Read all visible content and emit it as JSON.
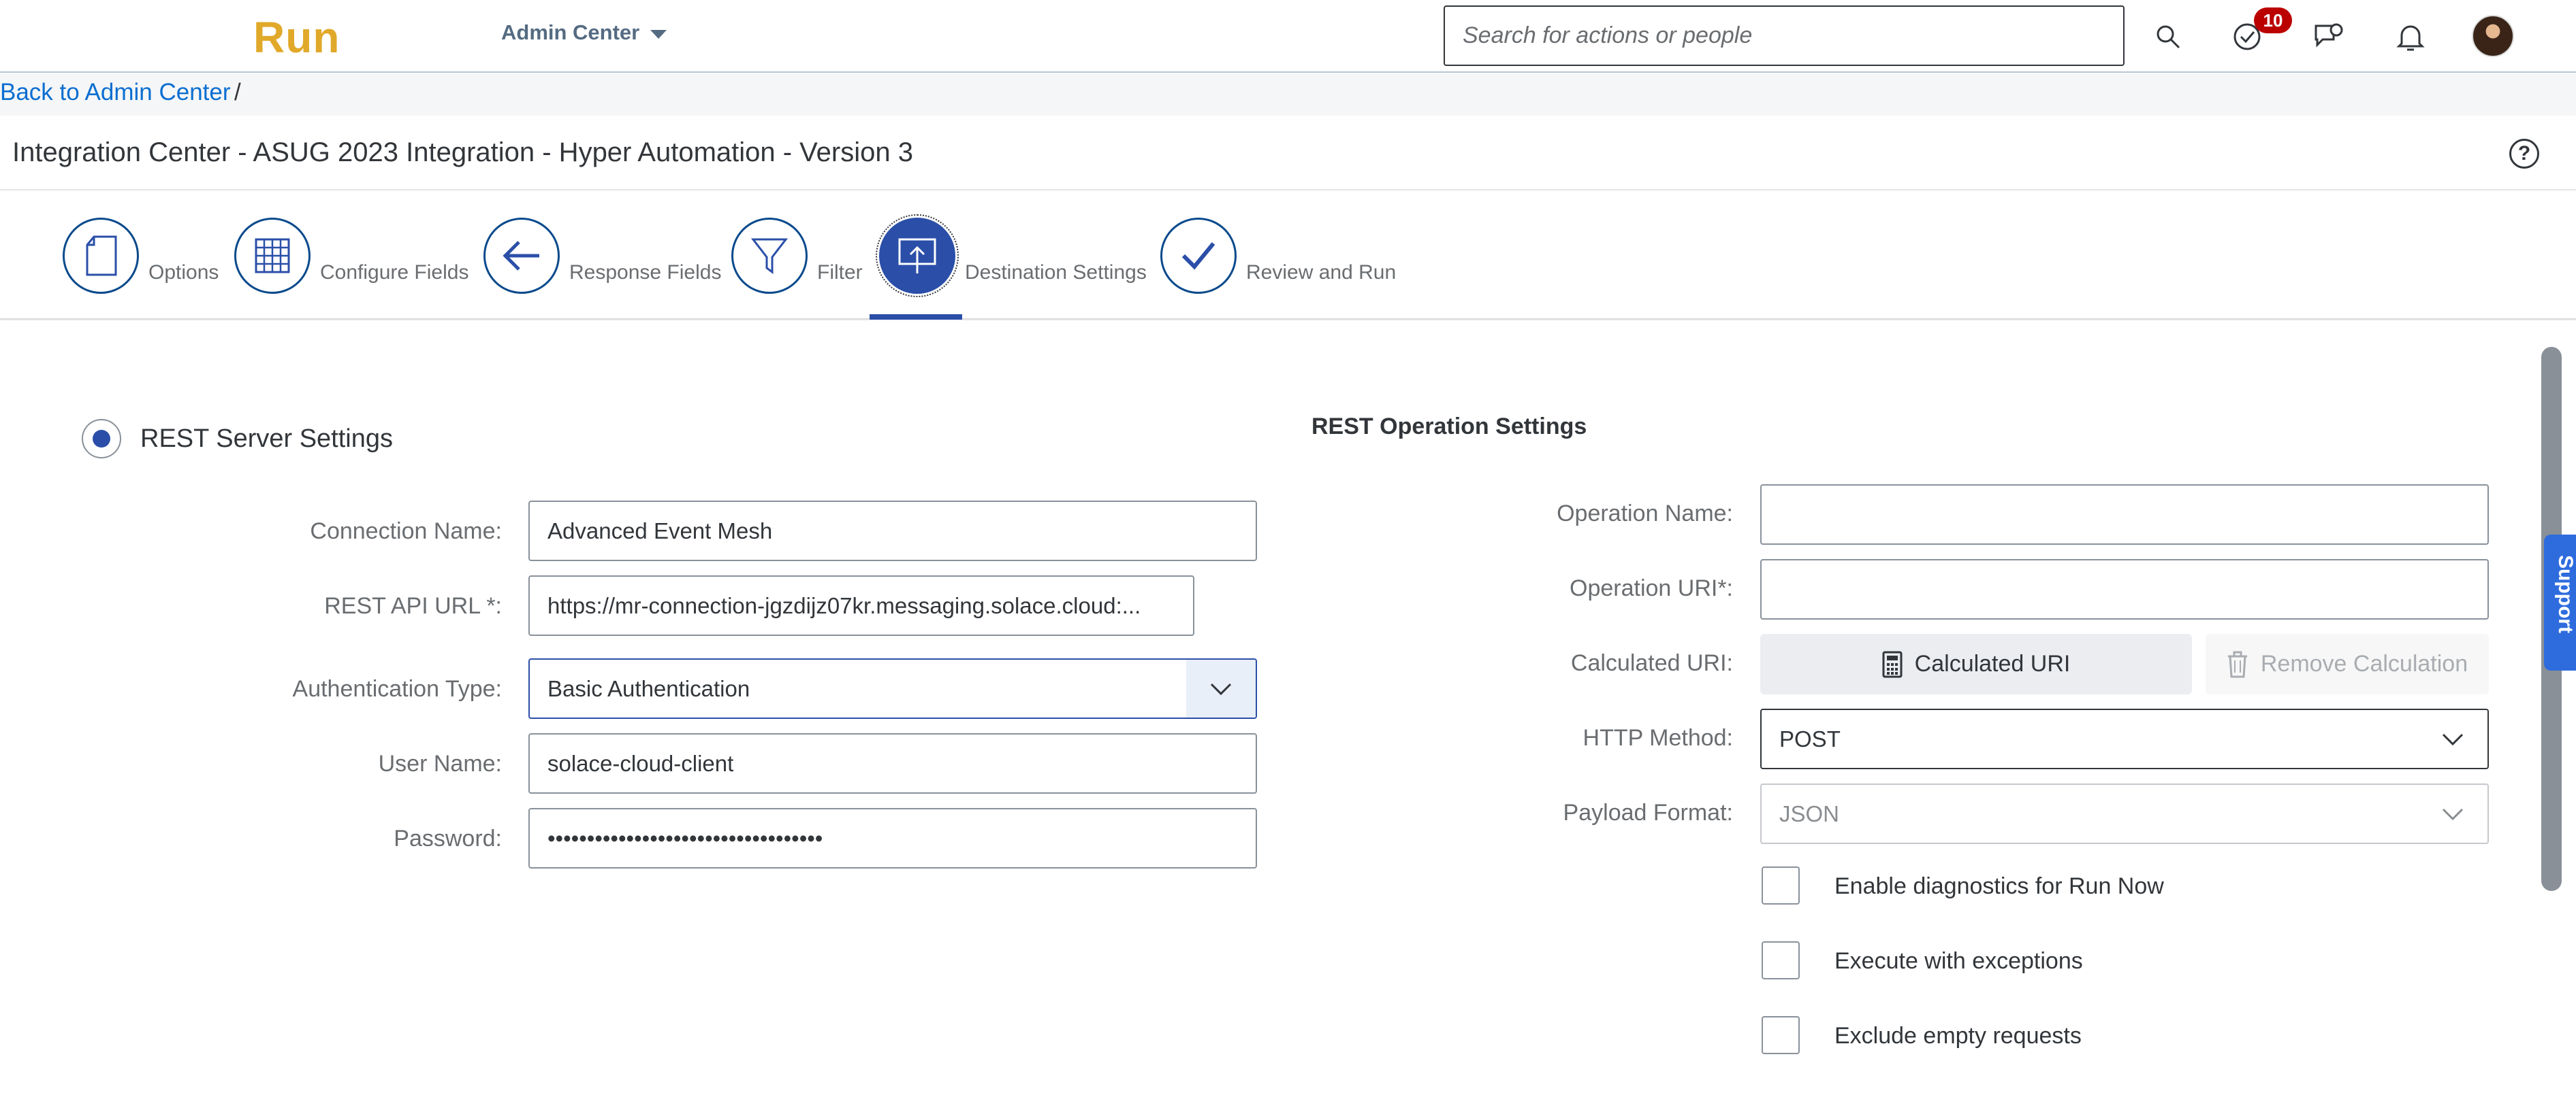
{
  "shell": {
    "logo": "Run",
    "module": "Admin Center",
    "search_placeholder": "Search for actions or people",
    "todo_count": "10"
  },
  "breadcrumb": {
    "link": "Back to Admin Center",
    "separator": "/"
  },
  "page": {
    "title": "Integration Center - ASUG 2023 Integration - Hyper Automation - Version 3",
    "help": "?"
  },
  "steps": [
    {
      "label": "Options"
    },
    {
      "label": "Configure Fields"
    },
    {
      "label": "Response Fields"
    },
    {
      "label": "Filter"
    },
    {
      "label": "Destination Settings"
    },
    {
      "label": "Review and Run"
    }
  ],
  "rest_server": {
    "heading": "REST Server Settings",
    "connection_name_label": "Connection Name:",
    "connection_name": "Advanced Event Mesh",
    "api_url_label": "REST API URL *:",
    "api_url": "https://mr-connection-jgzdijz07kr.messaging.solace.cloud:...",
    "auth_type_label": "Authentication Type:",
    "auth_type": "Basic Authentication",
    "user_name_label": "User Name:",
    "user_name": "solace-cloud-client",
    "password_label": "Password:",
    "password": "•••••••••••••••••••••••••••••••••••"
  },
  "rest_operation": {
    "heading": "REST Operation Settings",
    "operation_name_label": "Operation Name:",
    "operation_name": "",
    "operation_uri_label": "Operation URI*:",
    "operation_uri": "",
    "calculated_uri_label": "Calculated URI:",
    "calculated_uri_button": "Calculated URI",
    "remove_calculation_button": "Remove Calculation",
    "http_method_label": "HTTP Method:",
    "http_method": "POST",
    "payload_format_label": "Payload Format:",
    "payload_format": "JSON",
    "checkboxes": [
      {
        "label": "Enable diagnostics for Run Now",
        "checked": false
      },
      {
        "label": "Execute with exceptions",
        "checked": false
      },
      {
        "label": "Exclude empty requests",
        "checked": false
      }
    ]
  },
  "support_tab": "Support",
  "colors": {
    "brand": "#e1a92a",
    "accent": "#2b4fa8",
    "link": "#0a6ed1",
    "badge": "#bb0000"
  }
}
